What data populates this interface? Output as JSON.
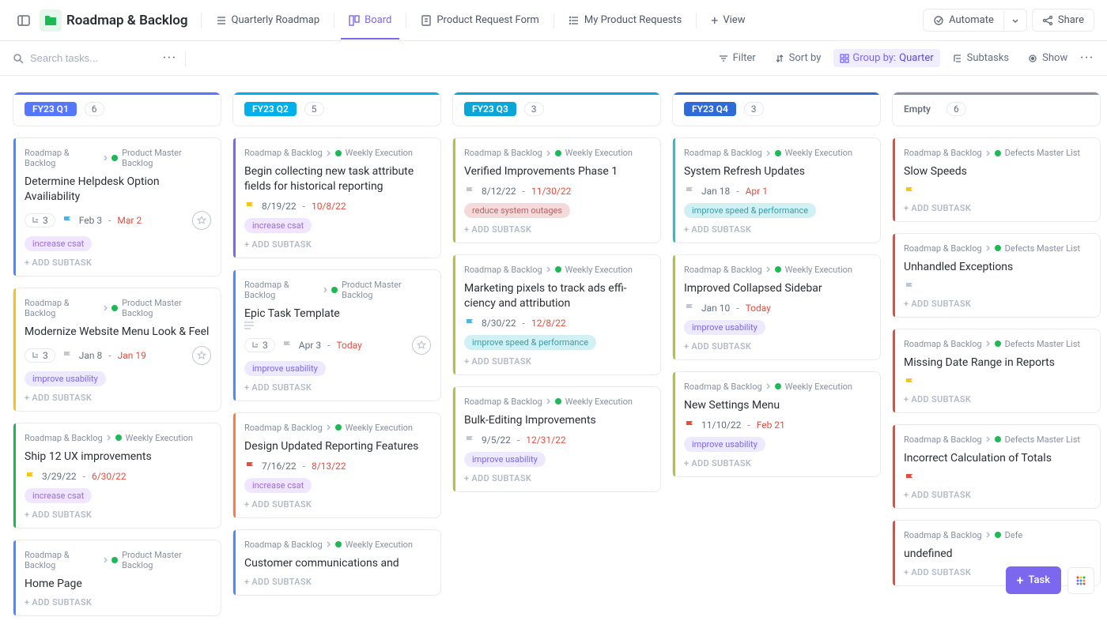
{
  "header": {
    "title": "Roadmap & Backlog",
    "views": [
      {
        "label": "Quarterly Roadmap"
      },
      {
        "label": "Board"
      },
      {
        "label": "Product Request Form"
      },
      {
        "label": "My Product Requests"
      }
    ],
    "add_view": "View",
    "automate": "Automate",
    "share": "Share"
  },
  "toolbar": {
    "search_placeholder": "Search tasks...",
    "filter": "Filter",
    "sort": "Sort by",
    "group_label": "Group by:",
    "group_value": "Quarter",
    "subtasks": "Subtasks",
    "show": "Show"
  },
  "columns": [
    {
      "title": "FY23 Q1",
      "count": "6",
      "color": "c1",
      "cards": [
        {
          "stripe": "blue",
          "bc1": "Roadmap & Backlog",
          "bc2": "Product Master Backlog",
          "title": "Determine Helpdesk Option Availiability",
          "sub": "3",
          "flag": "#4fb2e6",
          "d1": "Feb 3",
          "d2": "Mar 2",
          "tag": "increase csat",
          "tagc": "csat",
          "star": true
        },
        {
          "stripe": "yellow",
          "bc1": "Roadmap & Backlog",
          "bc2": "Product Master Backlog",
          "title": "Modernize Website Menu Look & Feel",
          "sub": "3",
          "flag": "#c1c7d0",
          "d1": "Jan 8",
          "d2": "Jan 19",
          "tag": "improve usability",
          "tagc": "usability",
          "star": true
        },
        {
          "stripe": "green",
          "bc1": "Roadmap & Backlog",
          "bc2": "Weekly Execution",
          "title": "Ship 12 UX improvements",
          "flag": "#f5c518",
          "d1": "3/29/22",
          "d2": "6/30/22",
          "tag": "increase csat",
          "tagc": "csat"
        },
        {
          "stripe": "blue",
          "bc1": "Roadmap & Backlog",
          "bc2": "Product Master Backlog",
          "title": "Home Page"
        }
      ]
    },
    {
      "title": "FY23 Q2",
      "count": "5",
      "color": "c2",
      "cards": [
        {
          "stripe": "purple",
          "bc1": "Roadmap & Backlog",
          "bc2": "Weekly Execution",
          "title": "Begin collecting new task attribute fields for historical reporting",
          "flag": "#f5c518",
          "d1": "8/19/22",
          "d2": "10/8/22",
          "tag": "increase csat",
          "tagc": "csat"
        },
        {
          "stripe": "blue",
          "bc1": "Roadmap & Backlog",
          "bc2": "Product Master Backlog",
          "title": "Epic Task Template",
          "sub": "3",
          "flag": "#c1c7d0",
          "d1": "Apr 3",
          "d2": "Today",
          "tag": "improve usability",
          "tagc": "usability",
          "star": true,
          "desc": true
        },
        {
          "stripe": "orange",
          "bc1": "Roadmap & Backlog",
          "bc2": "Weekly Execution",
          "title": "Design Updated Reporting Features",
          "flag": "#e84c3d",
          "d1": "7/16/22",
          "d2": "8/13/22",
          "tag": "increase csat",
          "tagc": "csat"
        },
        {
          "stripe": "blue",
          "bc1": "Roadmap & Backlog",
          "bc2": "Weekly Execution",
          "title": "Customer communications and"
        }
      ]
    },
    {
      "title": "FY23 Q3",
      "count": "3",
      "color": "c3",
      "cards": [
        {
          "stripe": "olive",
          "bc1": "Roadmap & Backlog",
          "bc2": "Weekly Execution",
          "title": "Verified Improvements Phase 1",
          "flag": "#c1c7d0",
          "d1": "8/12/22",
          "d2": "11/30/22",
          "tag": "reduce system outages",
          "tagc": "outage"
        },
        {
          "stripe": "olive",
          "bc1": "Roadmap & Backlog",
          "bc2": "Weekly Execution",
          "title": "Marketing pixels to track ads effi­ciency and attribution",
          "flag": "#4fb2e6",
          "d1": "8/30/22",
          "d2": "12/8/22",
          "tag": "improve speed & performance",
          "tagc": "speed"
        },
        {
          "stripe": "olive",
          "bc1": "Roadmap & Backlog",
          "bc2": "Weekly Execution",
          "title": "Bulk-Editing Improvements",
          "flag": "#c1c7d0",
          "d1": "9/5/22",
          "d2": "12/31/22",
          "tag": "improve usability",
          "tagc": "usability"
        }
      ]
    },
    {
      "title": "FY23 Q4",
      "count": "3",
      "color": "c4",
      "cards": [
        {
          "stripe": "teal",
          "bc1": "Roadmap & Backlog",
          "bc2": "Weekly Execution",
          "title": "System Refresh Updates",
          "flag": "#c1c7d0",
          "d1": "Jan 18",
          "d2": "Apr 1",
          "tag": "improve speed & performance",
          "tagc": "speed"
        },
        {
          "stripe": "olive",
          "bc1": "Roadmap & Backlog",
          "bc2": "Weekly Execution",
          "title": "Improved Collapsed Sidebar",
          "flag": "#c1c7d0",
          "d1": "Jan 10",
          "d2": "Today",
          "tag": "improve usability",
          "tagc": "usability"
        },
        {
          "stripe": "olive",
          "bc1": "Roadmap & Backlog",
          "bc2": "Weekly Execution",
          "title": "New Settings Menu",
          "flag": "#e84c3d",
          "d1": "11/10/22",
          "d2": "Feb 21",
          "tag": "improve usability",
          "tagc": "usability"
        }
      ]
    },
    {
      "title": "Empty",
      "count": "6",
      "color": "c5",
      "empty": true,
      "cards": [
        {
          "stripe": "red",
          "bc1": "Roadmap & Backlog",
          "bc2": "Defects Master List",
          "title": "Slow Speeds",
          "flag": "#f5c518"
        },
        {
          "stripe": "red",
          "bc1": "Roadmap & Backlog",
          "bc2": "Defects Master List",
          "title": "Unhandled Exceptions",
          "flag": "#c1c7d0"
        },
        {
          "stripe": "red",
          "bc1": "Roadmap & Backlog",
          "bc2": "Defects Master List",
          "title": "Missing Date Range in Reports",
          "flag": "#f5c518"
        },
        {
          "stripe": "red",
          "bc1": "Roadmap & Backlog",
          "bc2": "Defects Master List",
          "title": "Incorrect Calculation of Totals",
          "flag": "#e84c3d"
        },
        {
          "stripe": "red",
          "bc1": "Roadmap & Backlog",
          "bc2": "Defe"
        }
      ]
    }
  ],
  "add_subtask": "+ ADD SUBTASK",
  "fab": {
    "task": "Task"
  }
}
